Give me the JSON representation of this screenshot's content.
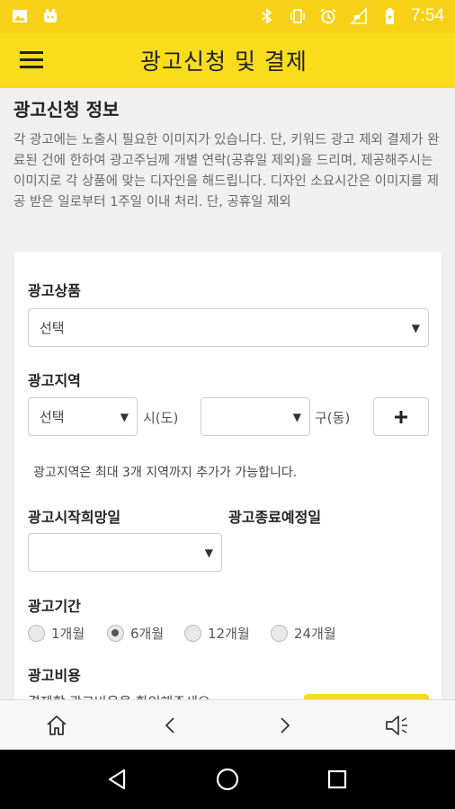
{
  "status_bar": {
    "time": "7:54",
    "left_icons": [
      "image-icon",
      "notification-app-icon"
    ],
    "right_icons": [
      "bluetooth-icon",
      "vibrate-icon",
      "alarm-icon",
      "no-signal-icon",
      "battery-charging-icon"
    ]
  },
  "app_bar": {
    "title": "광고신청 및 결제",
    "menu_icon": "hamburger-menu-icon"
  },
  "info": {
    "section_title": "광고신청 정보",
    "description": "각 광고에는 노출시 필요한 이미지가 있습니다. 단, 키워드 광고 제외 결제가 완료된 건에 한하여 광고주님께 개별 연락(공휴일 제외)을 드리며, 제공해주시는 이미지로 각 상품에 맞는 디자인을 해드립니다. 디자인 소요시간은 이미지를 제공 받은 일로부터 1주일 이내 처리. 단, 공휴일 제외"
  },
  "form": {
    "product": {
      "label": "광고상품",
      "selected": "선택"
    },
    "region": {
      "label": "광고지역",
      "city_selected": "선택",
      "city_unit": "시(도)",
      "district_selected": "",
      "district_unit": "구(동)",
      "add_icon": "plus-icon",
      "note": "광고지역은 최대 3개 지역까지 추가가 가능합니다."
    },
    "start_date": {
      "label": "광고시작희망일",
      "selected": ""
    },
    "end_date": {
      "label": "광고종료예정일"
    },
    "period": {
      "label": "광고기간",
      "options": [
        {
          "label": "1개월",
          "checked": false
        },
        {
          "label": "6개월",
          "checked": true
        },
        {
          "label": "12개월",
          "checked": false
        },
        {
          "label": "24개월",
          "checked": false
        }
      ]
    },
    "cost": {
      "label": "광고비용",
      "partial_text": "결제할 광고비용을 확인해주세요"
    }
  },
  "bottom_nav": {
    "icons": [
      "home-icon",
      "back-arrow-icon",
      "forward-arrow-icon",
      "speaker-icon"
    ]
  },
  "system_nav": {
    "icons": [
      "back-triangle-icon",
      "home-circle-icon",
      "recents-square-icon"
    ]
  },
  "colors": {
    "accent": "#f9dc1c",
    "status_bar": "#f7d117"
  }
}
